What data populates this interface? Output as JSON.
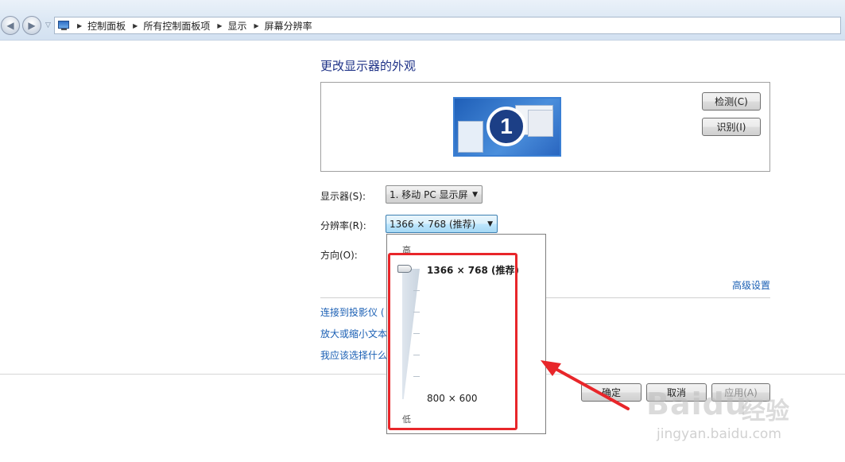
{
  "breadcrumb": [
    "控制面板",
    "所有控制面板项",
    "显示",
    "屏幕分辨率"
  ],
  "title": "更改显示器的外观",
  "monitor_number": "1",
  "buttons": {
    "detect": "检测(C)",
    "identify": "识别(I)",
    "ok": "确定",
    "cancel": "取消",
    "apply": "应用(A)"
  },
  "display": {
    "label": "显示器(S):",
    "value": "1. 移动 PC 显示屏"
  },
  "resolution": {
    "label": "分辨率(R):",
    "value": "1366 × 768 (推荐)",
    "slider": {
      "high_label": "高",
      "low_label": "低",
      "top_option": "1366 × 768 (推荐)",
      "bottom_option": "800 × 600",
      "level": 1.0
    }
  },
  "orientation": {
    "label": "方向(O):"
  },
  "advanced_link": "高级设置",
  "links": [
    "连接到投影仪 (",
    "放大或缩小文本",
    "我应该选择什么"
  ],
  "watermark": {
    "brand": "Baidu",
    "brand_cn": "经验",
    "url": "jingyan.baidu.com"
  },
  "colors": {
    "accent_link": "#1a5fb4",
    "highlight_box": "#e8262a",
    "title": "#1e3287"
  }
}
